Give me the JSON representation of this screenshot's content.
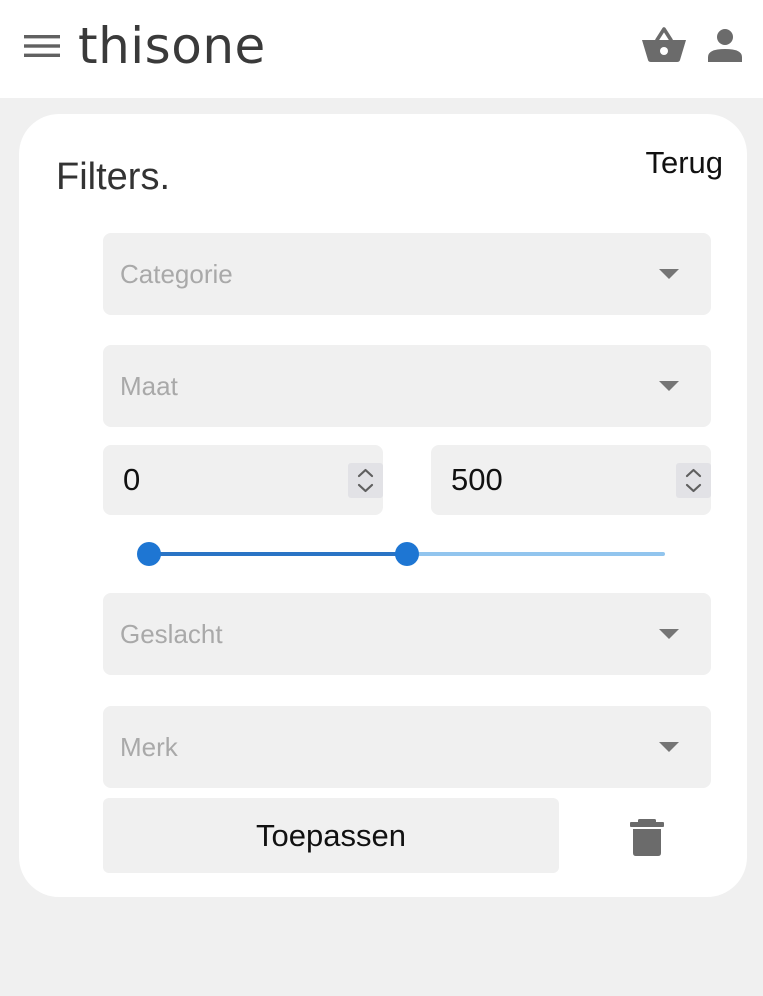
{
  "header": {
    "logo_text": "thisone",
    "icons": {
      "menu": "hamburger-menu-icon",
      "basket": "shopping-basket-icon",
      "user": "user-account-icon"
    }
  },
  "filters": {
    "title": "Filters.",
    "back_label": "Terug",
    "category": {
      "placeholder": "Categorie"
    },
    "size": {
      "placeholder": "Maat"
    },
    "price_range": {
      "min_value": "0",
      "max_value": "500",
      "slider_low_fraction": 0.0,
      "slider_high_fraction": 0.5
    },
    "gender": {
      "placeholder": "Geslacht"
    },
    "brand": {
      "placeholder": "Merk"
    },
    "apply_label": "Toepassen",
    "clear_icon": "trash-icon"
  },
  "colors": {
    "accent": "#1e76d3",
    "track_light": "#92c5ee",
    "field_background": "#f0f0f0",
    "icon_gray": "#757575"
  }
}
